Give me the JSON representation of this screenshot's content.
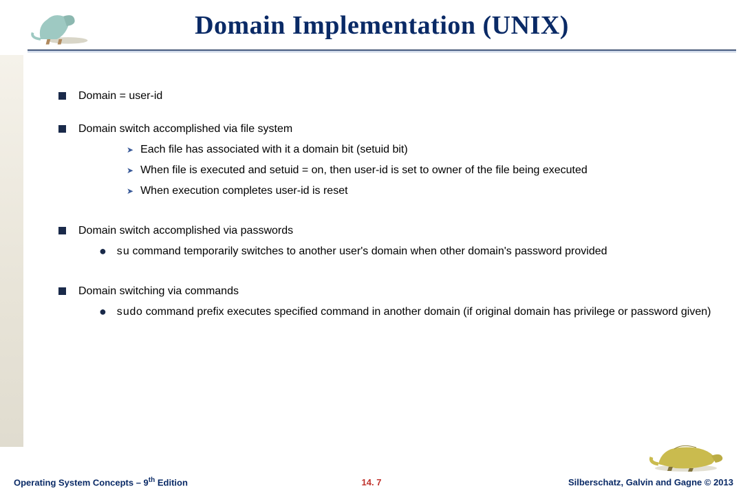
{
  "header": {
    "title": "Domain Implementation (UNIX)"
  },
  "bullets": {
    "b1": "Domain = user-id",
    "b2": "Domain switch accomplished via file system",
    "b2_sub": {
      "s1": "Each file has associated with it a domain bit (setuid bit)",
      "s2": "When file is executed and setuid = on, then user-id is set to owner of the file being executed",
      "s3": " When execution completes user-id is reset"
    },
    "b3": "Domain switch accomplished via passwords",
    "b3_sub": {
      "code": "su",
      "rest": " command temporarily switches to another user's domain when other domain's password provided"
    },
    "b4": "Domain switching via commands",
    "b4_sub": {
      "code": "sudo",
      "rest": " command prefix executes specified command in another domain (if original domain has privilege or password given)"
    }
  },
  "footer": {
    "left_a": "Operating System Concepts – 9",
    "left_b": "th",
    "left_c": " Edition",
    "center": "14. 7",
    "right": "Silberschatz, Galvin and Gagne © 2013"
  }
}
